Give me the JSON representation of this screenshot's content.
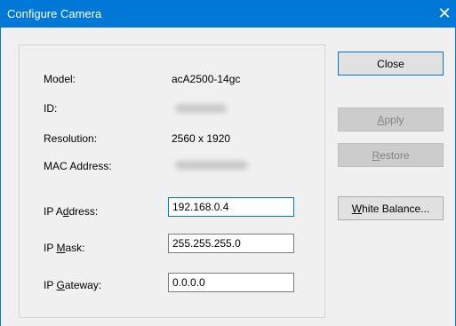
{
  "window": {
    "title": "Configure Camera"
  },
  "labels": {
    "model": "Model:",
    "id": "ID:",
    "resolution": "Resolution:",
    "mac": "MAC Address:",
    "ip_address_pre": "IP A",
    "ip_address_key": "d",
    "ip_address_post": "dress:",
    "ip_mask_pre": "IP ",
    "ip_mask_key": "M",
    "ip_mask_post": "ask:",
    "ip_gateway_pre": "IP ",
    "ip_gateway_key": "G",
    "ip_gateway_post": "ateway:"
  },
  "values": {
    "model": "acA2500-14gc",
    "resolution": "2560 x 1920"
  },
  "fields": {
    "ip_address": "192.168.0.4",
    "ip_mask": "255.255.255.0",
    "ip_gateway": "0.0.0.0"
  },
  "buttons": {
    "close": "Close",
    "apply_key": "A",
    "apply_rest": "pply",
    "restore_key": "R",
    "restore_rest": "estore",
    "white_balance_key": "W",
    "white_balance_rest": "hite Balance..."
  }
}
